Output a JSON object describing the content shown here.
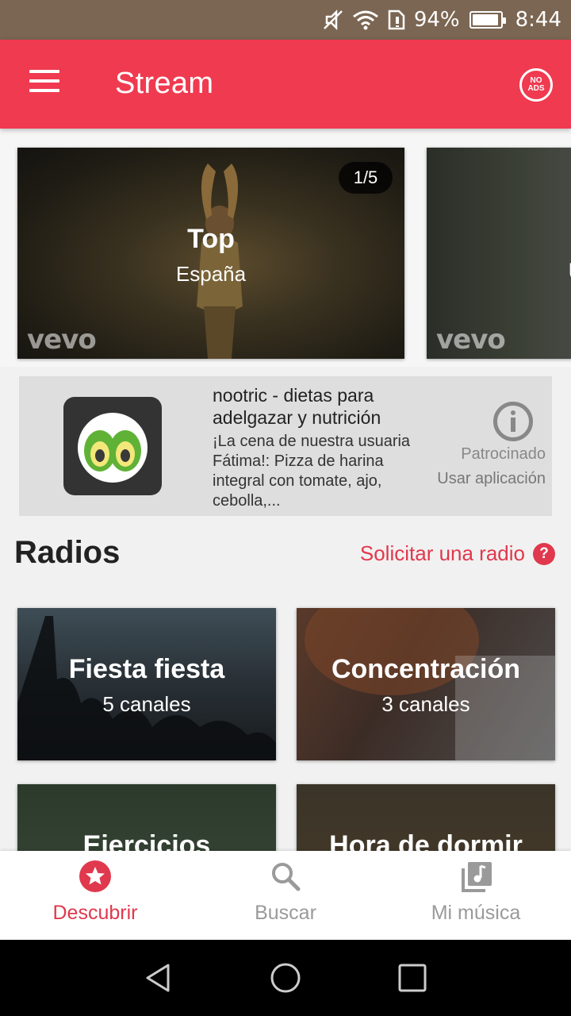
{
  "status_bar": {
    "battery_percent": "94%",
    "battery_level": 0.94,
    "time": "8:44",
    "icons": [
      "mute-icon",
      "wifi-icon",
      "sim-icon",
      "battery-icon"
    ]
  },
  "app_bar": {
    "title": "Stream",
    "menu_icon": "menu-icon",
    "noads_line1": "NO",
    "noads_line2": "ADS",
    "color": "#f03a50"
  },
  "carousel": {
    "cards": [
      {
        "counter": "1/5",
        "title": "Top",
        "subtitle": "España",
        "brand": "vevo"
      },
      {
        "partial_text": "U",
        "brand": "vevo"
      }
    ]
  },
  "ad": {
    "title": "nootric - dietas para adelgazar y nutrición",
    "body": "¡La cena de nuestra usuaria Fátima!: Pizza de harina integral con tomate, ajo, cebolla,...",
    "sponsored": "Patrocinado",
    "install": "Usar aplicación",
    "info_icon": "info-icon"
  },
  "radios": {
    "title": "Radios",
    "request_link": "Solicitar una radio",
    "help_icon": "?",
    "items": [
      {
        "title": "Fiesta fiesta",
        "subtitle": "5 canales"
      },
      {
        "title": "Concentración",
        "subtitle": "3 canales"
      },
      {
        "title": "Ejercicios"
      },
      {
        "title": "Hora de dormir"
      }
    ]
  },
  "bottom_nav": {
    "items": [
      {
        "label": "Descubrir",
        "icon": "star-icon",
        "active": true
      },
      {
        "label": "Buscar",
        "icon": "search-icon",
        "active": false
      },
      {
        "label": "Mi música",
        "icon": "music-library-icon",
        "active": false
      }
    ],
    "active_color": "#e0384d",
    "inactive_color": "#9a9a9a"
  },
  "system_nav": {
    "icons": [
      "back-icon",
      "home-icon",
      "recents-icon"
    ]
  }
}
